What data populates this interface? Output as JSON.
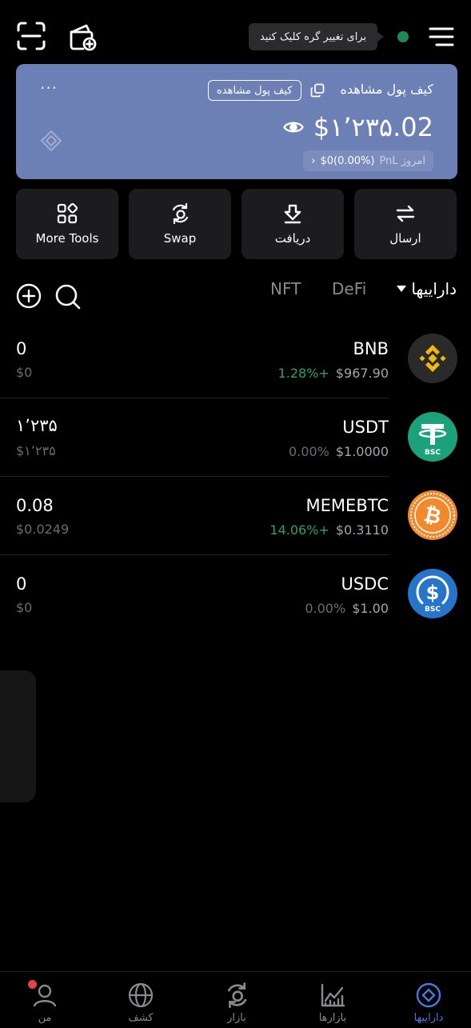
{
  "header": {
    "tooltip": "برای تغییر گره کلیک کنید",
    "icons": [
      "scan-icon",
      "add-wallet-icon",
      "menu-icon"
    ]
  },
  "wallet": {
    "title": "کیف پول مشاهده",
    "chip": "کیف پول مشاهده",
    "balance": "$۱٬۲۳۵.02",
    "pnl_label": "PnL امروز",
    "pnl_value": "$0(0.00%)",
    "pnl_arrow": "›",
    "more": "···",
    "color": "#6d80b5"
  },
  "actions": [
    {
      "label": "More Tools",
      "icon": "grid-icon"
    },
    {
      "label": "Swap",
      "icon": "swap-icon"
    },
    {
      "label": "دریافت",
      "icon": "receive-icon"
    },
    {
      "label": "ارسال",
      "icon": "send-icon"
    }
  ],
  "tabs": {
    "assets": "داراییها",
    "defi": "DeFi",
    "nft": "NFT"
  },
  "tokens": [
    {
      "symbol": "BNB",
      "amount": "0",
      "usd": "$0",
      "change": "1.28%+",
      "price": "$967.90",
      "trend": "up"
    },
    {
      "symbol": "USDT",
      "amount": "۱٬۲۳۵",
      "usd": "$۱٬۲۳۵",
      "change": "0.00%",
      "price": "$1.0000",
      "trend": "flat",
      "badge": "BSC"
    },
    {
      "symbol": "MEMEBTC",
      "amount": "0.08",
      "usd": "$0.0249",
      "change": "14.06%+",
      "price": "$0.3110",
      "trend": "up"
    },
    {
      "symbol": "USDC",
      "amount": "0",
      "usd": "$0",
      "change": "0.00%",
      "price": "$1.00",
      "trend": "flat",
      "badge": "BSC"
    }
  ],
  "nav": [
    {
      "label": "من",
      "icon": "profile-icon",
      "active": false
    },
    {
      "label": "کشف",
      "icon": "discover-icon",
      "active": false
    },
    {
      "label": "بازار",
      "icon": "swap-market-icon",
      "active": false
    },
    {
      "label": "بازارها",
      "icon": "markets-icon",
      "active": false
    },
    {
      "label": "داراییها",
      "icon": "assets-icon",
      "active": true
    }
  ],
  "colors": {
    "accent": "#4b78e0",
    "positive": "#2e9e73",
    "card_bg": "#1c1c1e",
    "status_dot": "#1e8a5c"
  }
}
